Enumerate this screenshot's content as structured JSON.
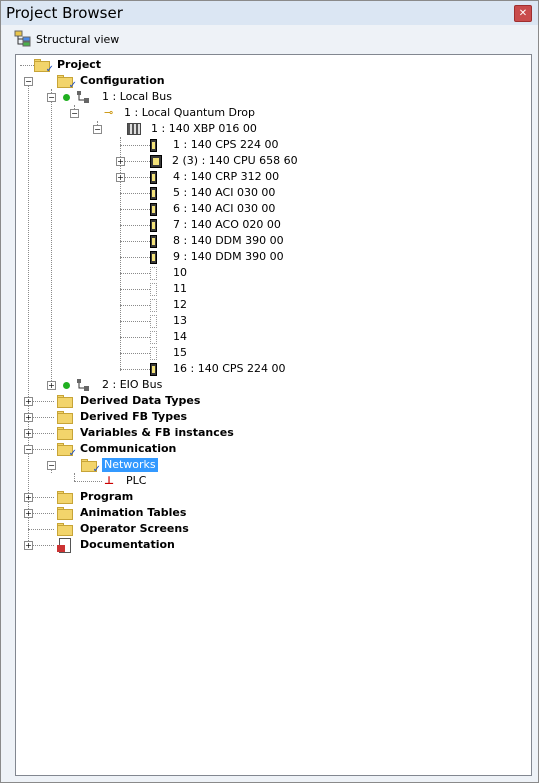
{
  "window": {
    "title": "Project Browser"
  },
  "toolbar": {
    "view_label": "Structural view"
  },
  "tree": {
    "project": "Project",
    "configuration": "Configuration",
    "local_bus": "1 : Local Bus",
    "local_drop": "1 : Local Quantum Drop",
    "rack": "1 : 140 XBP 016 00",
    "slots": [
      "1 : 140 CPS 224 00",
      "2 (3) : 140 CPU 658 60",
      "4 : 140 CRP 312 00",
      "5 : 140 ACI 030 00",
      "6 : 140 ACI 030 00",
      "7 : 140 ACO 020 00",
      "8 : 140 DDM 390 00",
      "9 : 140 DDM 390 00",
      "10",
      "11",
      "12",
      "13",
      "14",
      "15",
      "16 : 140 CPS 224 00"
    ],
    "eio_bus": "2 : EIO Bus",
    "derived_data_types": "Derived Data Types",
    "derived_fb_types": "Derived FB Types",
    "variables": "Variables & FB instances",
    "communication": "Communication",
    "networks": "Networks",
    "plc": "PLC",
    "program": "Program",
    "animation_tables": "Animation Tables",
    "operator_screens": "Operator Screens",
    "documentation": "Documentation"
  }
}
